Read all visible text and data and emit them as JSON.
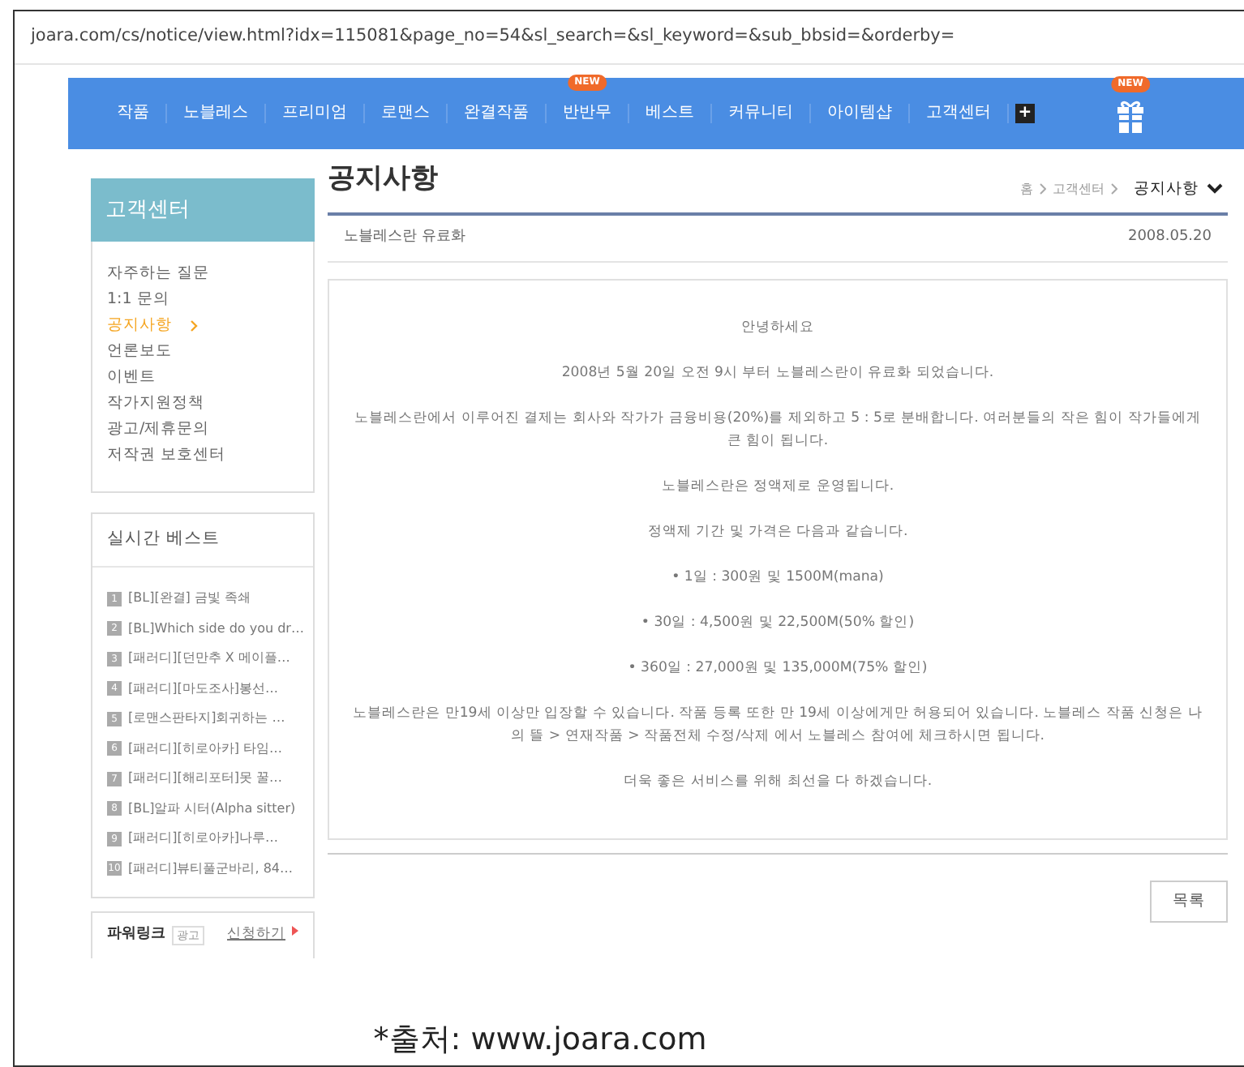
{
  "address_bar": {
    "url": "joara.com/cs/notice/view.html?idx=115081&page_no=54&sl_search=&sl_keyword=&sub_bbsid=&orderby="
  },
  "nav": {
    "items": [
      {
        "label": "작품"
      },
      {
        "label": "노블레스"
      },
      {
        "label": "프리미엄"
      },
      {
        "label": "로맨스"
      },
      {
        "label": "완결작품"
      },
      {
        "label": "반반무",
        "badge": "NEW"
      },
      {
        "label": "베스트"
      },
      {
        "label": "커뮤니티"
      },
      {
        "label": "아이템샵"
      },
      {
        "label": "고객센터"
      }
    ],
    "more": "+",
    "gift_badge": "NEW"
  },
  "sidebar": {
    "title": "고객센터",
    "menu": [
      {
        "label": "자주하는 질문",
        "selected": false
      },
      {
        "label": "1:1 문의",
        "selected": false
      },
      {
        "label": "공지사항",
        "selected": true
      },
      {
        "label": "언론보도",
        "selected": false
      },
      {
        "label": "이벤트",
        "selected": false
      },
      {
        "label": "작가지원정책",
        "selected": false
      },
      {
        "label": "광고/제휴문의",
        "selected": false
      },
      {
        "label": "저작권 보호센터",
        "selected": false
      }
    ],
    "realtime": {
      "title": "실시간 베스트",
      "items": [
        {
          "rank": "1",
          "title": "[BL][완결] 금빛 족쇄"
        },
        {
          "rank": "2",
          "title": "[BL]Which side do you dr…"
        },
        {
          "rank": "3",
          "title": "[패러디][던만추 X 메이플…"
        },
        {
          "rank": "4",
          "title": "[패러디][마도조사]봉선…"
        },
        {
          "rank": "5",
          "title": "[로맨스판타지]회귀하는 …"
        },
        {
          "rank": "6",
          "title": "[패러디][히로아카] 타임…"
        },
        {
          "rank": "7",
          "title": "[패러디][해리포터]못 꿀…"
        },
        {
          "rank": "8",
          "title": "[BL]알파 시터(Alpha sitter)"
        },
        {
          "rank": "9",
          "title": "[패러디][히로아카]나루…"
        },
        {
          "rank": "10",
          "title": "[패러디]뷰티풀군바리, 84…"
        }
      ]
    },
    "powerlink": {
      "title": "파워링크",
      "tag": "광고",
      "apply": "신청하기"
    }
  },
  "main": {
    "title": "공지사항",
    "breadcrumb": [
      "홈",
      "고객센터"
    ],
    "select": "공지사항",
    "subject": "노블레스란 유료화",
    "date": "2008.05.20",
    "body": [
      "안녕하세요",
      "2008년 5월 20일 오전 9시 부터 노블레스란이 유료화 되었습니다.",
      "노블레스란에서 이루어진 결제는 회사와 작가가 금융비용(20%)를 제외하고 5 : 5로 분배합니다. 여러분들의 작은 힘이 작가들에게 큰 힘이 됩니다.",
      "노블레스란은 정액제로 운영됩니다.",
      "정액제 기간 및 가격은 다음과 같습니다.",
      "• 1일 : 300원 및 1500M(mana)",
      "• 30일 : 4,500원 및 22,500M(50% 할인)",
      "• 360일 : 27,000원 및 135,000M(75% 할인)",
      "노블레스란은 만19세 이상만 입장할 수 있습니다. 작품 등록 또한 만 19세 이상에게만 허용되어 있습니다. 노블레스 작품 신청은 나의 뜰 > 연재작품 > 작품전체 수정/삭제 에서 노블레스 참여에 체크하시면 됩니다.",
      "더욱 좋은 서비스를 위해 최선을 다 하겠습니다."
    ],
    "list_button": "목록"
  },
  "caption": "*출처: www.joara.com"
}
